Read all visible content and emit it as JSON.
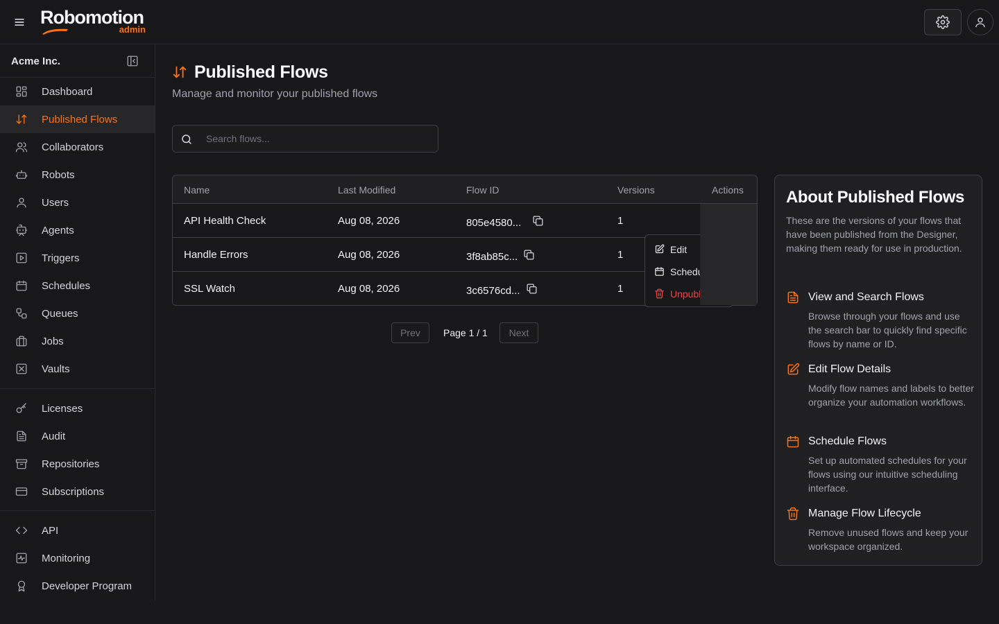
{
  "app": {
    "brand": "Robomotion",
    "brand_sub": "admin"
  },
  "sidebar": {
    "org_name": "Acme Inc.",
    "groups": [
      [
        {
          "label": "Dashboard",
          "icon": "dashboard-icon"
        },
        {
          "label": "Published Flows",
          "icon": "arrows-up-down-icon",
          "active": true
        },
        {
          "label": "Collaborators",
          "icon": "users-icon"
        },
        {
          "label": "Robots",
          "icon": "robot-icon"
        },
        {
          "label": "Users",
          "icon": "user-icon"
        },
        {
          "label": "Agents",
          "icon": "agent-icon"
        },
        {
          "label": "Triggers",
          "icon": "play-square-icon"
        },
        {
          "label": "Schedules",
          "icon": "calendar-icon"
        },
        {
          "label": "Queues",
          "icon": "queue-icon"
        },
        {
          "label": "Jobs",
          "icon": "briefcase-icon"
        },
        {
          "label": "Vaults",
          "icon": "vault-icon"
        }
      ],
      [
        {
          "label": "Licenses",
          "icon": "key-icon"
        },
        {
          "label": "Audit",
          "icon": "file-text-icon"
        },
        {
          "label": "Repositories",
          "icon": "archive-icon"
        },
        {
          "label": "Subscriptions",
          "icon": "credit-card-icon"
        }
      ],
      [
        {
          "label": "API",
          "icon": "code-icon"
        },
        {
          "label": "Monitoring",
          "icon": "activity-icon"
        },
        {
          "label": "Developer Program",
          "icon": "award-icon"
        }
      ]
    ]
  },
  "page": {
    "title": "Published Flows",
    "subtitle": "Manage and monitor your published flows",
    "search_placeholder": "Search flows..."
  },
  "table": {
    "headers": [
      "Name",
      "Last Modified",
      "Flow ID",
      "Versions",
      "Actions"
    ],
    "rows": [
      {
        "name": "API Health Check",
        "modified": "Aug 08, 2026",
        "flow_id": "805e4580...",
        "versions": "1"
      },
      {
        "name": "Handle Errors",
        "modified": "Aug 08, 2026",
        "flow_id": "3f8ab85c...",
        "versions": "1"
      },
      {
        "name": "SSL Watch",
        "modified": "Aug 08, 2026",
        "flow_id": "3c6576cd...",
        "versions": "1"
      }
    ]
  },
  "actions_menu": {
    "items": [
      {
        "label": "Edit",
        "icon": "edit-icon"
      },
      {
        "label": "Schedule",
        "icon": "calendar-icon"
      },
      {
        "label": "Unpublish",
        "icon": "trash-icon",
        "danger": true
      }
    ]
  },
  "pagination": {
    "prev": "Prev",
    "page_text": "Page 1 / 1",
    "next": "Next"
  },
  "about": {
    "title": "About Published Flows",
    "description": "These are the versions of your flows that have been published from the Designer, making them ready for use in production.",
    "features": [
      {
        "title": "View and Search Flows",
        "desc": "Browse through your flows and use the search bar to quickly find specific flows by name or ID.",
        "icon": "document-icon"
      },
      {
        "title": "Edit Flow Details",
        "desc": "Modify flow names and labels to better organize your automation workflows.",
        "icon": "edit-icon"
      },
      {
        "title": "Schedule Flows",
        "desc": "Set up automated schedules for your flows using our intuitive scheduling interface.",
        "icon": "calendar-icon"
      },
      {
        "title": "Manage Flow Lifecycle",
        "desc": "Remove unused flows and keep your workspace organized.",
        "icon": "trash-icon"
      }
    ]
  },
  "colors": {
    "accent": "#f97316",
    "danger": "#ef4444",
    "background": "#18181b"
  }
}
